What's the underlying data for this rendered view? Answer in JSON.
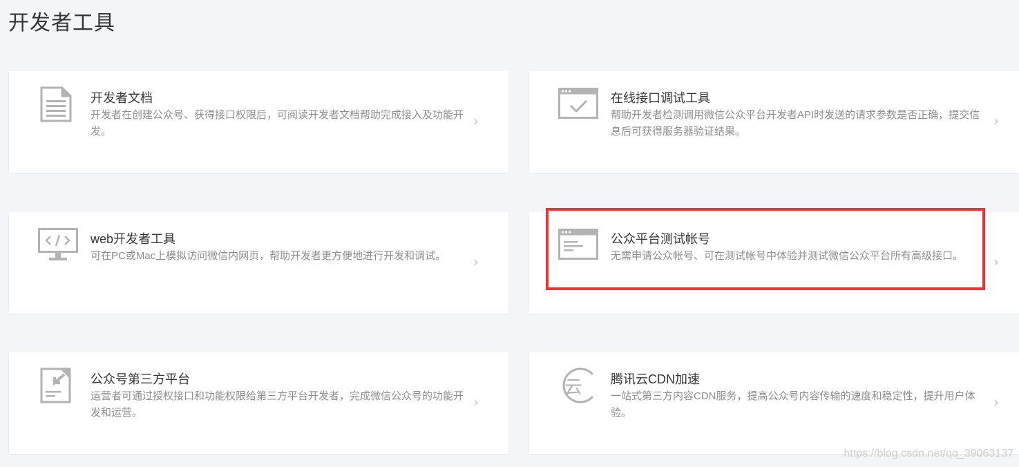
{
  "page": {
    "title": "开发者工具"
  },
  "cards": [
    {
      "title": "开发者文档",
      "desc": "开发者在创建公众号、获得接口权限后，可阅读开发者文档帮助完成接入及功能开发。",
      "icon": "document-icon"
    },
    {
      "title": "在线接口调试工具",
      "desc": "帮助开发者检测调用微信公众平台开发者API时发送的请求参数是否正确，提交信息后可获得服务器验证结果。",
      "icon": "browser-check-icon"
    },
    {
      "title": "web开发者工具",
      "desc": "可在PC或Mac上模拟访问微信内网页，帮助开发者更方便地进行开发和调试。",
      "icon": "monitor-code-icon"
    },
    {
      "title": "公众平台测试帐号",
      "desc": "无需申请公众帐号、可在测试帐号中体验并测试微信公众平台所有高级接口。",
      "icon": "browser-window-icon"
    },
    {
      "title": "公众号第三方平台",
      "desc": "运营者可通过授权接口和功能权限给第三方平台开发者，完成微信公众号的功能开发和运营。",
      "icon": "authorize-doc-icon"
    },
    {
      "title": "腾讯云CDN加速",
      "desc": "一站式第三方内容CDN服务，提高公众号内容传输的速度和稳定性，提升用户体验。",
      "icon": "tencent-cloud-icon"
    }
  ],
  "chevron": "›",
  "cloud_glyph": "云",
  "watermark": "https://blog.csdn.net/qq_39063137",
  "colors": {
    "icon": "#b3b3b3",
    "highlight": "#ee3236",
    "background": "#f4f5f9"
  }
}
